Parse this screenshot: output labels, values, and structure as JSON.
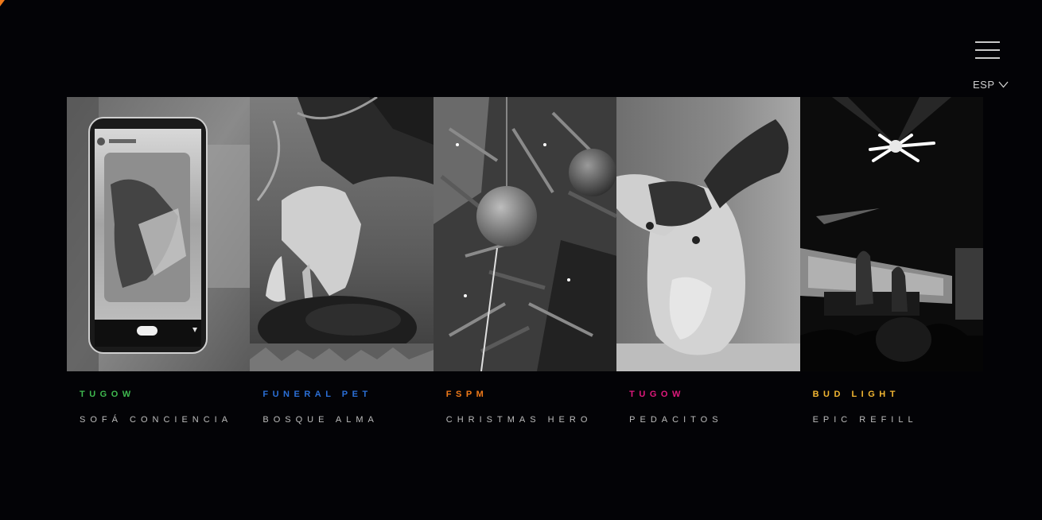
{
  "header": {
    "language": "ESP",
    "menu_icon": "hamburger-menu-icon",
    "dropdown_icon": "chevron-down-icon"
  },
  "accent_color": "#f07a1a",
  "projects": [
    {
      "brand": "TUGOW",
      "brand_color": "#3fb94f",
      "title": "SOFÁ CONCIENCIA",
      "image": "phone-instagram-story-image"
    },
    {
      "brand": "FUNERAL PET",
      "brand_color": "#2b6fd6",
      "title": "BOSQUE ALMA",
      "image": "hand-planting-in-soil-image"
    },
    {
      "brand": "FSPM",
      "brand_color": "#f07a1a",
      "title": "CHRISTMAS HERO",
      "image": "christmas-tree-ornaments-image"
    },
    {
      "brand": "TUGOW",
      "brand_color": "#e0197d",
      "title": "PEDACITOS",
      "image": "plush-bunny-toy-image"
    },
    {
      "brand": "BUD LIGHT",
      "brand_color": "#f2b632",
      "title": "EPIC REFILL",
      "image": "concert-stage-lights-image"
    }
  ]
}
